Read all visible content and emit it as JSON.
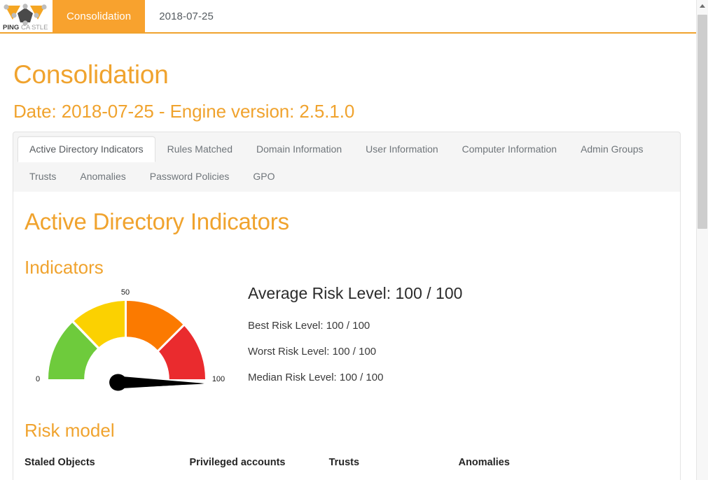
{
  "navbar": {
    "brand_icon": "pingcastle-logo-icon",
    "brand_name": "PING CASTLE",
    "items": [
      {
        "label": "Consolidation",
        "active": true
      },
      {
        "label": "2018-07-25",
        "active": false
      }
    ]
  },
  "page": {
    "title": "Consolidation",
    "subtitle": "Date: 2018-07-25 - Engine version: 2.5.1.0"
  },
  "tabs": {
    "row1": [
      {
        "label": "Active Directory Indicators",
        "active": true
      },
      {
        "label": "Rules Matched",
        "active": false
      },
      {
        "label": "Domain Information",
        "active": false
      },
      {
        "label": "User Information",
        "active": false
      },
      {
        "label": "Computer Information",
        "active": false
      },
      {
        "label": "Admin Groups",
        "active": false
      }
    ],
    "row2": [
      {
        "label": "Trusts",
        "active": false
      },
      {
        "label": "Anomalies",
        "active": false
      },
      {
        "label": "Password Policies",
        "active": false
      },
      {
        "label": "GPO",
        "active": false
      }
    ]
  },
  "content": {
    "section_title": "Active Directory Indicators",
    "indicators_title": "Indicators",
    "risk_model_title": "Risk model",
    "average_risk": "Average Risk Level: 100 / 100",
    "best_risk": "Best Risk Level: 100 / 100",
    "worst_risk": "Worst Risk Level: 100 / 100",
    "median_risk": "Median Risk Level: 100 / 100"
  },
  "risk_model_table": {
    "headers": [
      "Staled Objects",
      "Privileged accounts",
      "Trusts",
      "Anomalies"
    ]
  },
  "chart_data": {
    "type": "gauge",
    "title": "Indicators",
    "value": 100,
    "min": 0,
    "max": 100,
    "tick_labels": [
      "0",
      "50",
      "100"
    ],
    "tick_values": [
      0,
      50,
      100
    ],
    "needle_color": "#000000",
    "segments": [
      {
        "from": 0,
        "to": 30,
        "color": "#6ECB3C",
        "name": "low"
      },
      {
        "from": 30,
        "to": 50,
        "color": "#FBD101",
        "name": "medium"
      },
      {
        "from": 50,
        "to": 75,
        "color": "#FB7A00",
        "name": "high"
      },
      {
        "from": 75,
        "to": 100,
        "color": "#EA2B2E",
        "name": "critical"
      }
    ],
    "readouts": {
      "average": 100,
      "best": 100,
      "worst": 100,
      "median": 100,
      "scale_max": 100
    }
  },
  "scrollbar": {
    "up_arrow_icon": "chevron-up-icon",
    "position_percent": 0
  },
  "colors": {
    "brand_orange": "#F8A22E",
    "heading_orange": "#F0A32E",
    "gauge_green": "#6ECB3C",
    "gauge_yellow": "#FBD101",
    "gauge_orange": "#FB7A00",
    "gauge_red": "#EA2B2E"
  }
}
